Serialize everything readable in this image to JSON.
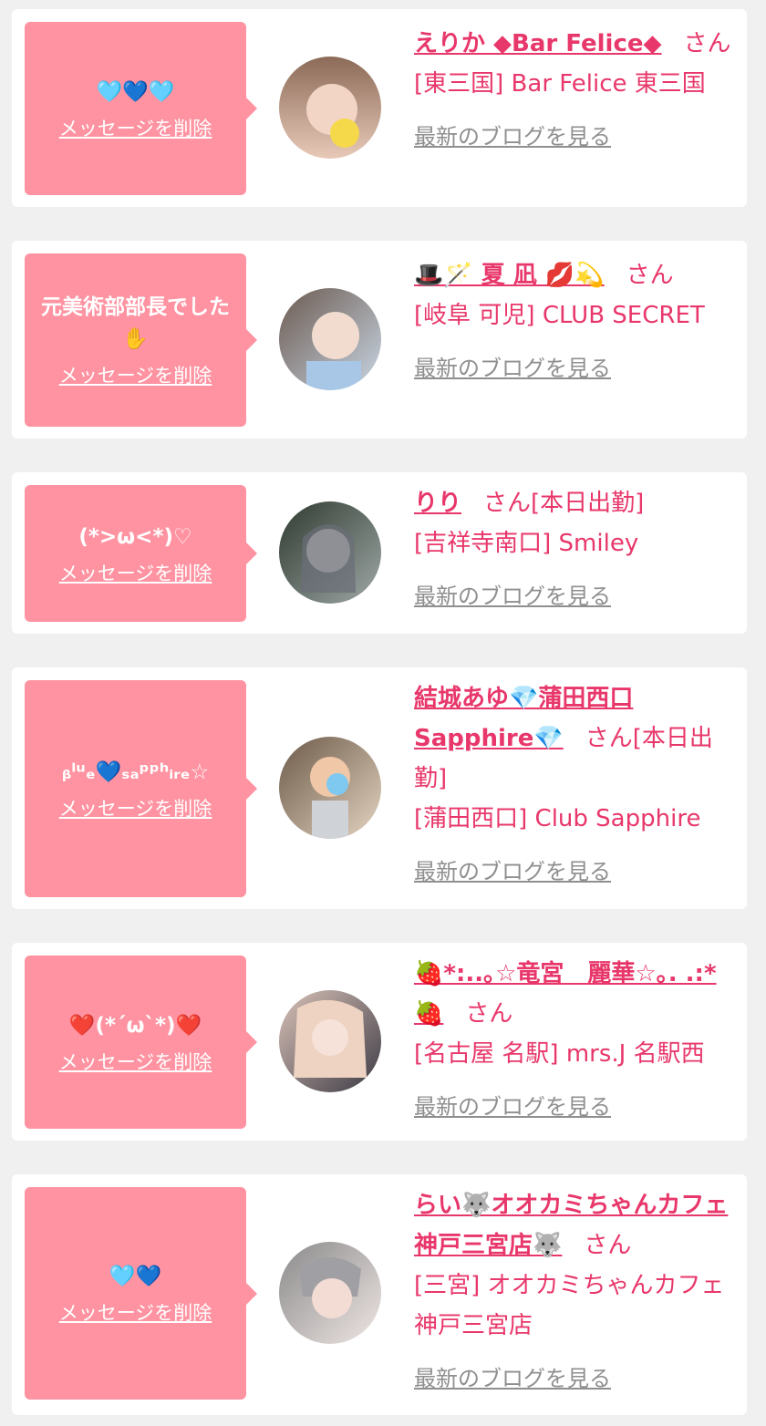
{
  "delete_label": "メッセージを削除",
  "honorific": "さん",
  "blog_label": "最新のブログを見る",
  "colors": {
    "bubble": "#ff93a1",
    "name": "#e8376a",
    "blog_link": "#8f8f8f"
  },
  "cards": [
    {
      "message": "🩵💙🩵",
      "name": "えりか ◆Bar Felice◆",
      "status": "",
      "shop": "[東三国] Bar Felice 東三国",
      "avatar": "avatar-photo"
    },
    {
      "message": "元美術部部長でした✋",
      "name": "🎩🪄 夏 凪 💋💫",
      "status": "",
      "shop": "[岐阜 可児] CLUB SECRET",
      "avatar": "avatar-photo"
    },
    {
      "message": "(*>ω<*)♡",
      "name": "りり",
      "status": "[本日出勤]",
      "shop": "[吉祥寺南口] Smiley",
      "avatar": "avatar-photo"
    },
    {
      "message": "ᵦˡᵘₑ💙ₛₐᵖᵖʰᵢᵣₑ☆",
      "name": "結城あゆ💎蒲田西口Sapphire💎",
      "status": "[本日出勤]",
      "shop": "[蒲田西口] Club Sapphire",
      "avatar": "avatar-photo"
    },
    {
      "message": "❤️(*´ω`*)❤️",
      "name": "🍓*:..｡☆竜宮　麗華☆｡. .:*🍓",
      "status": "",
      "shop": "[名古屋 名駅] mrs.J 名駅西",
      "avatar": "avatar-photo"
    },
    {
      "message": "🩵💙",
      "name": "らい🐺オオカミちゃんカフェ神戸三宮店🐺",
      "status": "",
      "shop": "[三宮] オオカミちゃんカフェ神戸三宮店",
      "avatar": "avatar-photo"
    }
  ]
}
